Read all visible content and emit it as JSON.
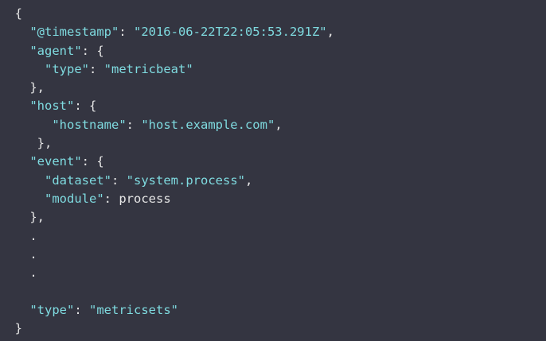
{
  "lines": [
    {
      "indent": "  ",
      "parts": [
        {
          "t": "{",
          "c": "punct"
        }
      ]
    },
    {
      "indent": "    ",
      "parts": [
        {
          "t": "\"@timestamp\"",
          "c": "key"
        },
        {
          "t": ": ",
          "c": "punct"
        },
        {
          "t": "\"2016-06-22T22:05:53.291Z\"",
          "c": "str"
        },
        {
          "t": ",",
          "c": "punct"
        }
      ]
    },
    {
      "indent": "    ",
      "parts": [
        {
          "t": "\"agent\"",
          "c": "key"
        },
        {
          "t": ": {",
          "c": "punct"
        }
      ]
    },
    {
      "indent": "      ",
      "parts": [
        {
          "t": "\"type\"",
          "c": "key"
        },
        {
          "t": ": ",
          "c": "punct"
        },
        {
          "t": "\"metricbeat\"",
          "c": "str"
        }
      ]
    },
    {
      "indent": "    ",
      "parts": [
        {
          "t": "},",
          "c": "punct"
        }
      ]
    },
    {
      "indent": "    ",
      "parts": [
        {
          "t": "\"host\"",
          "c": "key"
        },
        {
          "t": ": {",
          "c": "punct"
        }
      ]
    },
    {
      "indent": "       ",
      "parts": [
        {
          "t": "\"hostname\"",
          "c": "key"
        },
        {
          "t": ": ",
          "c": "punct"
        },
        {
          "t": "\"host.example.com\"",
          "c": "str"
        },
        {
          "t": ",",
          "c": "punct"
        }
      ]
    },
    {
      "indent": "     ",
      "parts": [
        {
          "t": "},",
          "c": "punct"
        }
      ]
    },
    {
      "indent": "    ",
      "parts": [
        {
          "t": "\"event\"",
          "c": "key"
        },
        {
          "t": ": {",
          "c": "punct"
        }
      ]
    },
    {
      "indent": "      ",
      "parts": [
        {
          "t": "\"dataset\"",
          "c": "key"
        },
        {
          "t": ": ",
          "c": "punct"
        },
        {
          "t": "\"system.process\"",
          "c": "str"
        },
        {
          "t": ",",
          "c": "punct"
        }
      ]
    },
    {
      "indent": "      ",
      "parts": [
        {
          "t": "\"module\"",
          "c": "key"
        },
        {
          "t": ": ",
          "c": "punct"
        },
        {
          "t": "process",
          "c": "plain"
        }
      ]
    },
    {
      "indent": "    ",
      "parts": [
        {
          "t": "},",
          "c": "punct"
        }
      ]
    },
    {
      "indent": "    ",
      "parts": [
        {
          "t": ".",
          "c": "dot"
        }
      ]
    },
    {
      "indent": "    ",
      "parts": [
        {
          "t": ".",
          "c": "dot"
        }
      ]
    },
    {
      "indent": "    ",
      "parts": [
        {
          "t": ".",
          "c": "dot"
        }
      ]
    },
    {
      "indent": "",
      "parts": []
    },
    {
      "indent": "    ",
      "parts": [
        {
          "t": "\"type\"",
          "c": "key"
        },
        {
          "t": ": ",
          "c": "punct"
        },
        {
          "t": "\"metricsets\"",
          "c": "str"
        }
      ]
    },
    {
      "indent": "  ",
      "parts": [
        {
          "t": "}",
          "c": "punct"
        }
      ]
    }
  ],
  "colors": {
    "background": "#343541",
    "key": "#7fdbe0",
    "string": "#7fdbe0",
    "punctuation": "#e6e6e6"
  }
}
